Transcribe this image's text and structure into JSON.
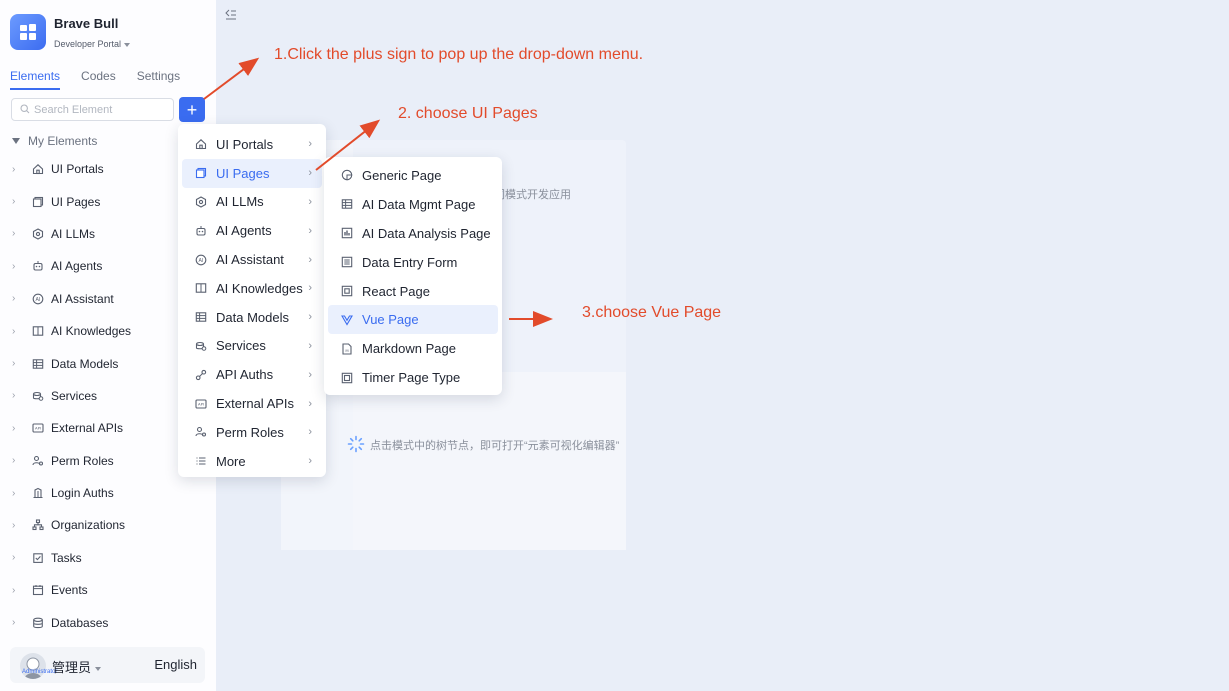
{
  "app": {
    "name": "Brave Bull",
    "subtitle": "Developer Portal"
  },
  "tabs": [
    {
      "label": "Elements",
      "active": true
    },
    {
      "label": "Codes",
      "active": false
    },
    {
      "label": "Settings",
      "active": false
    }
  ],
  "search": {
    "placeholder": "Search Element"
  },
  "add_button": {
    "label": "+"
  },
  "tree": {
    "root_label": "My Elements",
    "items": [
      {
        "label": "UI Portals",
        "icon": "home-icon"
      },
      {
        "label": "UI Pages",
        "icon": "pages-icon"
      },
      {
        "label": "AI LLMs",
        "icon": "llm-icon"
      },
      {
        "label": "AI Agents",
        "icon": "robot-icon"
      },
      {
        "label": "AI Assistant",
        "icon": "ai-assistant-icon"
      },
      {
        "label": "AI Knowledges",
        "icon": "book-icon"
      },
      {
        "label": "Data Models",
        "icon": "table-icon"
      },
      {
        "label": "Services",
        "icon": "services-icon"
      },
      {
        "label": "External APIs",
        "icon": "api-icon"
      },
      {
        "label": "Perm Roles",
        "icon": "roles-icon"
      },
      {
        "label": "Login Auths",
        "icon": "login-icon"
      },
      {
        "label": "Organizations",
        "icon": "org-icon"
      },
      {
        "label": "Tasks",
        "icon": "task-icon"
      },
      {
        "label": "Events",
        "icon": "events-icon"
      },
      {
        "label": "Databases",
        "icon": "database-icon"
      }
    ]
  },
  "user": {
    "name": "管理员",
    "avatar_caption": "Administrator",
    "language": "English"
  },
  "menu_level1": [
    {
      "label": "UI Portals",
      "icon": "home-icon",
      "active": false
    },
    {
      "label": "UI Pages",
      "icon": "pages-icon",
      "active": true
    },
    {
      "label": "AI LLMs",
      "icon": "llm-icon",
      "active": false
    },
    {
      "label": "AI Agents",
      "icon": "robot-icon",
      "active": false
    },
    {
      "label": "AI Assistant",
      "icon": "ai-assistant-icon",
      "active": false
    },
    {
      "label": "AI Knowledges",
      "icon": "book-icon",
      "active": false
    },
    {
      "label": "Data Models",
      "icon": "table-icon",
      "active": false
    },
    {
      "label": "Services",
      "icon": "services-icon",
      "active": false
    },
    {
      "label": "API Auths",
      "icon": "link-icon",
      "active": false
    },
    {
      "label": "External APIs",
      "icon": "api-icon",
      "active": false
    },
    {
      "label": "Perm Roles",
      "icon": "roles-icon",
      "active": false
    },
    {
      "label": "More",
      "icon": "list-icon",
      "active": false
    }
  ],
  "menu_level2": [
    {
      "label": "Generic Page",
      "icon": "generic-page-icon",
      "active": false
    },
    {
      "label": "AI Data Mgmt Page",
      "icon": "table-icon",
      "active": false
    },
    {
      "label": "AI Data Analysis Page",
      "icon": "bar-chart-icon",
      "active": false
    },
    {
      "label": "Data Entry Form",
      "icon": "form-icon",
      "active": false
    },
    {
      "label": "React Page",
      "icon": "react-icon",
      "active": false
    },
    {
      "label": "Vue Page",
      "icon": "vue-icon",
      "active": true
    },
    {
      "label": "Markdown Page",
      "icon": "markdown-icon",
      "active": false
    },
    {
      "label": "Timer Page Type",
      "icon": "timer-icon",
      "active": false
    }
  ],
  "background": {
    "hint_top": "不同模式开发应用",
    "hint_bottom": "点击模式中的树节点，即可打开“元素可视化编辑器”"
  },
  "annotations": {
    "step1": "1.Click the plus sign to pop up the drop-down menu.",
    "step2": "2. choose UI Pages",
    "step3": "3.choose Vue Page"
  },
  "colors": {
    "accent": "#3a6cf0",
    "annotation": "#e24b2b",
    "background": "#e9eef8",
    "sidebar": "#fdfdff"
  }
}
